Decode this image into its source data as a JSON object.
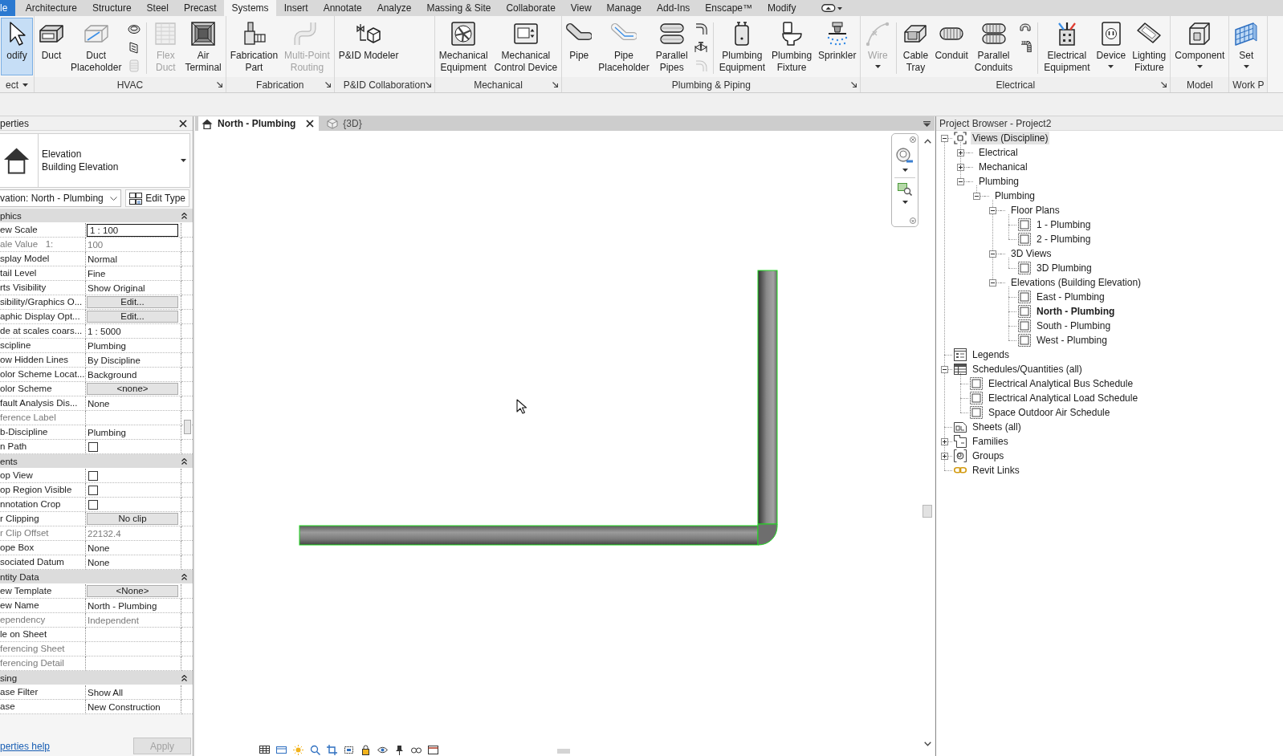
{
  "ribbon": {
    "tabs": [
      {
        "label": "le",
        "kind": "file",
        "selected": false
      },
      {
        "label": "Architecture",
        "kind": "tab",
        "selected": false
      },
      {
        "label": "Structure",
        "kind": "tab",
        "selected": false
      },
      {
        "label": "Steel",
        "kind": "tab",
        "selected": false
      },
      {
        "label": "Precast",
        "kind": "tab",
        "selected": false
      },
      {
        "label": "Systems",
        "kind": "tab",
        "selected": true
      },
      {
        "label": "Insert",
        "kind": "tab",
        "selected": false
      },
      {
        "label": "Annotate",
        "kind": "tab",
        "selected": false
      },
      {
        "label": "Analyze",
        "kind": "tab",
        "selected": false
      },
      {
        "label": "Massing & Site",
        "kind": "tab",
        "selected": false
      },
      {
        "label": "Collaborate",
        "kind": "tab",
        "selected": false
      },
      {
        "label": "View",
        "kind": "tab",
        "selected": false
      },
      {
        "label": "Manage",
        "kind": "tab",
        "selected": false
      },
      {
        "label": "Add-Ins",
        "kind": "tab",
        "selected": false
      },
      {
        "label": "Enscape™",
        "kind": "tab",
        "selected": false
      },
      {
        "label": "Modify",
        "kind": "tab",
        "selected": false
      }
    ],
    "panels": [
      {
        "label": "ect",
        "dropdown": true,
        "launcher": false,
        "items": [
          {
            "kind": "large",
            "label": "odify",
            "selected": true,
            "disabled": false,
            "dropdown": false
          }
        ]
      },
      {
        "label": "HVAC",
        "dropdown": false,
        "launcher": true,
        "items": [
          {
            "kind": "large",
            "label": "Duct",
            "selected": false,
            "disabled": false,
            "dropdown": false
          },
          {
            "kind": "large",
            "label": "Duct\nPlaceholder",
            "selected": false,
            "disabled": false,
            "dropdown": false
          },
          {
            "kind": "stack",
            "icons": [
              {
                "disabled": false
              },
              {
                "disabled": false
              },
              {
                "disabled": true
              }
            ]
          },
          {
            "kind": "separator"
          },
          {
            "kind": "large",
            "label": "Flex\nDuct",
            "selected": false,
            "disabled": true,
            "dropdown": false
          },
          {
            "kind": "large",
            "label": "Air\nTerminal",
            "selected": false,
            "disabled": false,
            "dropdown": false
          }
        ]
      },
      {
        "label": "Fabrication",
        "dropdown": false,
        "launcher": true,
        "items": [
          {
            "kind": "large",
            "label": "Fabrication\nPart",
            "selected": false,
            "disabled": false,
            "dropdown": false
          },
          {
            "kind": "large",
            "label": "Multi-Point\nRouting",
            "selected": false,
            "disabled": true,
            "dropdown": false
          }
        ]
      },
      {
        "label": "P&ID Collaboration",
        "dropdown": false,
        "launcher": true,
        "items": [
          {
            "kind": "large",
            "label": "P&ID Modeler",
            "selected": false,
            "disabled": false,
            "dropdown": false
          }
        ]
      },
      {
        "label": "Mechanical",
        "dropdown": false,
        "launcher": true,
        "items": [
          {
            "kind": "large",
            "label": "Mechanical\nEquipment",
            "selected": false,
            "disabled": false,
            "dropdown": false
          },
          {
            "kind": "large",
            "label": "Mechanical\nControl Device",
            "selected": false,
            "disabled": false,
            "dropdown": false
          }
        ]
      },
      {
        "label": "Plumbing & Piping",
        "dropdown": false,
        "launcher": true,
        "items": [
          {
            "kind": "large",
            "label": "Pipe",
            "selected": false,
            "disabled": false,
            "dropdown": false
          },
          {
            "kind": "large",
            "label": "Pipe\nPlaceholder",
            "selected": false,
            "disabled": false,
            "dropdown": false
          },
          {
            "kind": "large",
            "label": "Parallel\nPipes",
            "selected": false,
            "disabled": false,
            "dropdown": false
          },
          {
            "kind": "stack",
            "icons": [
              {
                "disabled": false
              },
              {
                "disabled": false
              },
              {
                "disabled": true
              }
            ]
          },
          {
            "kind": "separator"
          },
          {
            "kind": "large",
            "label": "Plumbing\nEquipment",
            "selected": false,
            "disabled": false,
            "dropdown": false
          },
          {
            "kind": "large",
            "label": "Plumbing\nFixture",
            "selected": false,
            "disabled": false,
            "dropdown": false
          },
          {
            "kind": "large",
            "label": "Sprinkler",
            "selected": false,
            "disabled": false,
            "dropdown": false
          }
        ]
      },
      {
        "label": "Electrical",
        "dropdown": false,
        "launcher": true,
        "items": [
          {
            "kind": "large",
            "label": "Wire",
            "selected": false,
            "disabled": true,
            "dropdown": true
          },
          {
            "kind": "separator"
          },
          {
            "kind": "large",
            "label": "Cable\nTray",
            "selected": false,
            "disabled": false,
            "dropdown": false
          },
          {
            "kind": "large",
            "label": "Conduit",
            "selected": false,
            "disabled": false,
            "dropdown": false
          },
          {
            "kind": "large",
            "label": "Parallel\nConduits",
            "selected": false,
            "disabled": false,
            "dropdown": false
          },
          {
            "kind": "stack",
            "icons": [
              {
                "disabled": false
              },
              {
                "disabled": false
              }
            ]
          },
          {
            "kind": "separator"
          },
          {
            "kind": "large",
            "label": "Electrical\nEquipment",
            "selected": false,
            "disabled": false,
            "dropdown": false
          },
          {
            "kind": "large",
            "label": "Device",
            "selected": false,
            "disabled": false,
            "dropdown": true
          },
          {
            "kind": "large",
            "label": "Lighting\nFixture",
            "selected": false,
            "disabled": false,
            "dropdown": false
          }
        ]
      },
      {
        "label": "Model",
        "dropdown": false,
        "launcher": false,
        "items": [
          {
            "kind": "large",
            "label": "Component",
            "selected": false,
            "disabled": false,
            "dropdown": true
          }
        ]
      },
      {
        "label": "Work P",
        "dropdown": false,
        "launcher": false,
        "items": [
          {
            "kind": "large",
            "label": "Set",
            "selected": false,
            "disabled": false,
            "dropdown": true
          }
        ]
      }
    ]
  },
  "properties": {
    "title": "perties",
    "type_name": "Elevation",
    "type_family": "Building Elevation",
    "instance_selector": "vation: North - Plumbing",
    "edit_type": "Edit Type",
    "groups": [
      {
        "label": "phics",
        "expanded": true,
        "rows": [
          {
            "label": "ew Scale",
            "kind": "input",
            "value": "1 : 100",
            "disabled": false
          },
          {
            "label": "ale Value   1:",
            "kind": "text",
            "value": "100",
            "disabled": true
          },
          {
            "label": "splay Model",
            "kind": "text",
            "value": "Normal",
            "disabled": false
          },
          {
            "label": "tail Level",
            "kind": "text",
            "value": "Fine",
            "disabled": false
          },
          {
            "label": "rts Visibility",
            "kind": "text",
            "value": "Show Original",
            "disabled": false
          },
          {
            "label": "sibility/Graphics O...",
            "kind": "button",
            "value": "Edit...",
            "disabled": false
          },
          {
            "label": "aphic Display Opt...",
            "kind": "button",
            "value": "Edit...",
            "disabled": false
          },
          {
            "label": "de at scales coars...",
            "kind": "text",
            "value": "1 : 5000",
            "disabled": false
          },
          {
            "label": "scipline",
            "kind": "text",
            "value": "Plumbing",
            "disabled": false
          },
          {
            "label": "ow Hidden Lines",
            "kind": "text",
            "value": "By Discipline",
            "disabled": false
          },
          {
            "label": "olor Scheme Locat...",
            "kind": "text",
            "value": "Background",
            "disabled": false
          },
          {
            "label": "olor Scheme",
            "kind": "button",
            "value": "<none>",
            "disabled": false
          },
          {
            "label": "fault Analysis Dis...",
            "kind": "text",
            "value": "None",
            "disabled": false
          },
          {
            "label": "ference Label",
            "kind": "text",
            "disabled": true
          },
          {
            "label": "b-Discipline",
            "kind": "text",
            "value": "Plumbing",
            "disabled": false
          },
          {
            "label": "n Path",
            "kind": "checkbox",
            "checked": false,
            "disabled": false
          }
        ]
      },
      {
        "label": "ents",
        "expanded": true,
        "rows": [
          {
            "label": "op View",
            "kind": "checkbox",
            "checked": false,
            "disabled": false
          },
          {
            "label": "op Region Visible",
            "kind": "checkbox",
            "checked": false,
            "disabled": false
          },
          {
            "label": "nnotation Crop",
            "kind": "checkbox",
            "checked": false,
            "disabled": false
          },
          {
            "label": "r Clipping",
            "kind": "button",
            "value": "No clip",
            "disabled": false
          },
          {
            "label": "r Clip Offset",
            "kind": "text",
            "value": "22132.4",
            "disabled": true
          },
          {
            "label": "ope Box",
            "kind": "text",
            "value": "None",
            "disabled": false
          },
          {
            "label": "sociated Datum",
            "kind": "text",
            "value": "None",
            "disabled": false
          }
        ]
      },
      {
        "label": "ntity Data",
        "expanded": true,
        "rows": [
          {
            "label": "ew Template",
            "kind": "button",
            "value": "<None>",
            "disabled": false
          },
          {
            "label": "ew Name",
            "kind": "text",
            "value": "North - Plumbing",
            "disabled": false
          },
          {
            "label": "ependency",
            "kind": "text",
            "value": "Independent",
            "disabled": true
          },
          {
            "label": "le on Sheet",
            "kind": "text",
            "disabled": false
          },
          {
            "label": "ferencing Sheet",
            "kind": "text",
            "disabled": true
          },
          {
            "label": "ferencing Detail",
            "kind": "text",
            "disabled": true
          }
        ]
      },
      {
        "label": "sing",
        "expanded": true,
        "rows": [
          {
            "label": "ase Filter",
            "kind": "text",
            "value": "Show All",
            "disabled": false
          },
          {
            "label": "ase",
            "kind": "text",
            "value": "New Construction",
            "disabled": false
          }
        ]
      }
    ],
    "help_link": "perties help",
    "apply": {
      "label": "Apply",
      "disabled": true
    }
  },
  "view": {
    "tabs": [
      {
        "label": "North - Plumbing",
        "kind": "elevation",
        "selected": true
      },
      {
        "label": "{3D}",
        "kind": "isometric",
        "selected": false
      }
    ]
  },
  "project_browser": {
    "title": "Project Browser - Project2",
    "tree": [
      {
        "label": "Views (Discipline)",
        "kind": "views",
        "expanded": true,
        "selected": true,
        "current": false,
        "children": [
          {
            "label": "Electrical",
            "kind": "folder",
            "expanded": false,
            "selected": false,
            "current": false
          },
          {
            "label": "Mechanical",
            "kind": "folder",
            "expanded": false,
            "selected": false,
            "current": false
          },
          {
            "label": "Plumbing",
            "kind": "folder",
            "expanded": true,
            "selected": false,
            "current": false,
            "children": [
              {
                "label": "Plumbing",
                "kind": "folder",
                "expanded": true,
                "selected": false,
                "current": false,
                "children": [
                  {
                    "label": "Floor Plans",
                    "kind": "folder",
                    "expanded": true,
                    "selected": false,
                    "current": false,
                    "children": [
                      {
                        "label": "1 - Plumbing",
                        "kind": "view",
                        "selected": false,
                        "current": false
                      },
                      {
                        "label": "2 - Plumbing",
                        "kind": "view",
                        "selected": false,
                        "current": false
                      }
                    ]
                  },
                  {
                    "label": "3D Views",
                    "kind": "folder",
                    "expanded": true,
                    "selected": false,
                    "current": false,
                    "children": [
                      {
                        "label": "3D Plumbing",
                        "kind": "view",
                        "selected": false,
                        "current": false
                      }
                    ]
                  },
                  {
                    "label": "Elevations (Building Elevation)",
                    "kind": "folder",
                    "expanded": true,
                    "selected": false,
                    "current": false,
                    "children": [
                      {
                        "label": "East - Plumbing",
                        "kind": "view",
                        "selected": false,
                        "current": false
                      },
                      {
                        "label": "North - Plumbing",
                        "kind": "view",
                        "selected": false,
                        "current": true
                      },
                      {
                        "label": "South - Plumbing",
                        "kind": "view",
                        "selected": false,
                        "current": false
                      },
                      {
                        "label": "West - Plumbing",
                        "kind": "view",
                        "selected": false,
                        "current": false
                      }
                    ]
                  }
                ]
              }
            ]
          }
        ]
      },
      {
        "label": "Legends",
        "kind": "legends",
        "selected": false,
        "current": false
      },
      {
        "label": "Schedules/Quantities (all)",
        "kind": "schedules",
        "expanded": true,
        "selected": false,
        "current": false,
        "children": [
          {
            "label": "Electrical Analytical Bus Schedule",
            "kind": "view",
            "selected": false,
            "current": false
          },
          {
            "label": "Electrical Analytical Load Schedule",
            "kind": "view",
            "selected": false,
            "current": false
          },
          {
            "label": "Space Outdoor Air Schedule",
            "kind": "view",
            "selected": false,
            "current": false
          }
        ]
      },
      {
        "label": "Sheets (all)",
        "kind": "sheets",
        "selected": false,
        "current": false
      },
      {
        "label": "Families",
        "kind": "families",
        "expanded": false,
        "selected": false,
        "current": false
      },
      {
        "label": "Groups",
        "kind": "groups",
        "expanded": false,
        "selected": false,
        "current": false
      },
      {
        "label": "Revit Links",
        "kind": "links",
        "selected": false,
        "current": false
      }
    ]
  }
}
